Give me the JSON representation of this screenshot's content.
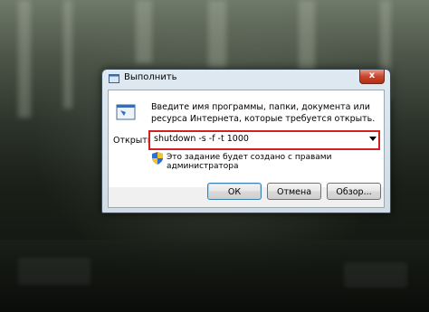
{
  "window": {
    "title": "Выполнить",
    "close_glyph": "x",
    "title_icon": "run-dialog-icon"
  },
  "dialog": {
    "description": "Введите имя программы, папки, документа или ресурса Интернета, которые требуется открыть.",
    "open_label": "Открыть:",
    "open_value": "shutdown -s -f -t 1000",
    "admin_note": "Это задание будет создано с правами администратора",
    "highlight_color": "#d12020"
  },
  "buttons": {
    "ok": "ОК",
    "cancel": "Отмена",
    "browse": "Обзор..."
  }
}
